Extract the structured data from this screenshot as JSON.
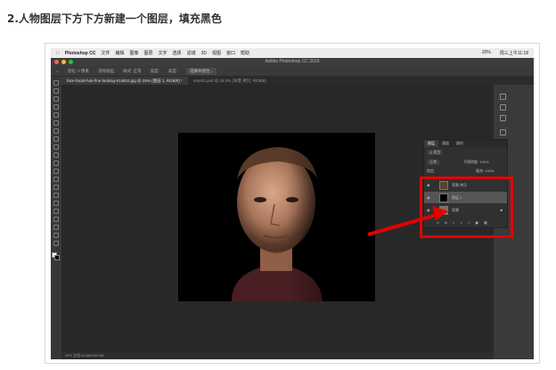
{
  "heading": "2.人物图层下方下方新建一个图层，填充黑色",
  "menubar": {
    "apple": "",
    "app": "Photoshop CC",
    "items": [
      "文件",
      "编辑",
      "图像",
      "图层",
      "文字",
      "选择",
      "滤镜",
      "3D",
      "视图",
      "窗口",
      "帮助"
    ],
    "status": [
      "20%",
      "周三上午11:18"
    ]
  },
  "window_title": "Adobe Photoshop CC 2019",
  "options_bar": {
    "feather": "羽化: 0 像素",
    "antialias": "消除锯齿",
    "style": "样式: 正常",
    "width": "宽度:",
    "height": "高度:",
    "select_mask": "选择并遮住..."
  },
  "tabs": [
    "face-facial-hair-fine-looking-614810.jpg @ 25% (图层 1, RGB/8) *",
    "rene01.psd @ 33.3% (背景 拷贝, RGB/8)"
  ],
  "statusbar": "25%     文档:53.6M/900.8M",
  "layers_panel": {
    "tabs": [
      "图层",
      "通道",
      "路径"
    ],
    "kind": "Q 类型",
    "blend": "正常",
    "opacity": "不透明度: 100%",
    "lock": "锁定:",
    "fill": "填充: 100%",
    "layers": [
      {
        "name": "背景 拷贝",
        "visible": true
      },
      {
        "name": "图层 1",
        "visible": true
      },
      {
        "name": "背景",
        "visible": true
      }
    ]
  },
  "colors": {
    "highlight_red": "#e60000",
    "ps_bg": "#323232",
    "canvas_bg": "#000000"
  }
}
